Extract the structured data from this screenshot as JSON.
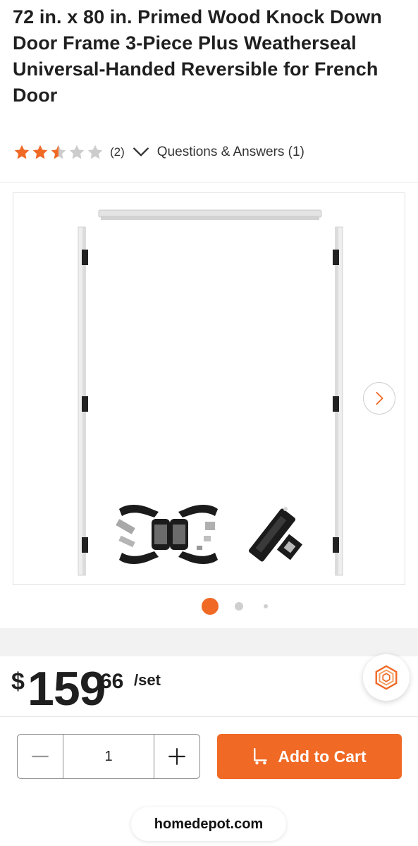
{
  "product": {
    "title": "72 in. x 80 in. Primed Wood Knock Down Door Frame 3-Piece Plus Weatherseal Universal-Handed Reversible for French Door"
  },
  "rating": {
    "value": 2.5,
    "max": 5,
    "review_count": "(2)",
    "qa_label": "Questions & Answers (1)",
    "star_color": "#f06925",
    "empty_star_color": "#cccccc"
  },
  "gallery": {
    "next_icon": "chevron-right-icon",
    "active_dot_color": "#f06925",
    "dot_count": 3,
    "active_index": 0
  },
  "price": {
    "dollar_sign": "$",
    "whole": "159",
    "cents": "66",
    "unit": "/set"
  },
  "cart": {
    "quantity": "1",
    "add_label": "Add to Cart",
    "button_color": "#f06925"
  },
  "browser": {
    "url": "homedepot.com"
  }
}
